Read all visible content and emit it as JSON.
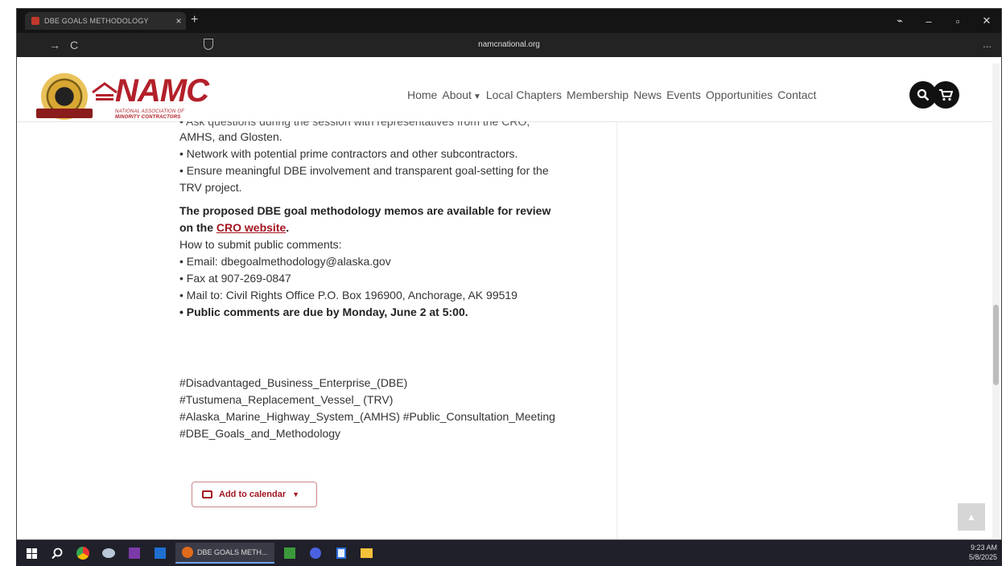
{
  "browser": {
    "tab_title": "DBE GOALS METHODOLOGY",
    "tab_close": "×",
    "new_tab": "+",
    "url": "namcnational.org",
    "back": "→",
    "reload": "C",
    "menu": "...",
    "window_controls": [
      "⌁",
      "–",
      "▫",
      "✕"
    ]
  },
  "site": {
    "logo_text": "NAMC",
    "logo_sub1": "NATIONAL ASSOCIATION OF",
    "logo_sub2": "MINORITY CONTRACTORS",
    "nav": [
      "Home",
      "About",
      "Local Chapters",
      "Membership",
      "News",
      "Events",
      "Opportunities",
      "Contact"
    ]
  },
  "content": {
    "cut_line": "• Ask questions during the session with representatives from the CRO,",
    "lines_block1": [
      "AMHS, and Glosten.",
      "• Network with potential prime contractors and other subcontractors.",
      "• Ensure meaningful DBE involvement and transparent goal-setting for the",
      "TRV project."
    ],
    "memo_line1": "The proposed DBE goal methodology memos are available for review",
    "memo_line2_prefix": "on the ",
    "memo_link": "CRO website",
    "memo_line2_suffix": ".",
    "lines_block2": [
      "How to submit public comments:",
      "• Email: dbegoalmethodology@alaska.gov",
      "• Fax at 907-269-0847",
      "• Mail to: Civil Rights Office P.O. Box 196900, Anchorage, AK 99519"
    ],
    "due_line": "• Public comments are due by Monday, June 2 at 5:00.",
    "hashtags": [
      "#Disadvantaged_Business_Enterprise_(DBE)",
      "#Tustumena_Replacement_Vessel_ (TRV)",
      "#Alaska_Marine_Highway_System_(AMHS) #Public_Consultation_Meeting",
      "#DBE_Goals_and_Methodology"
    ],
    "calendar_button": "Add to calendar"
  },
  "taskbar": {
    "active_app": "DBE GOALS METH...",
    "time": "9:23 AM",
    "date": "5/8/2025"
  }
}
